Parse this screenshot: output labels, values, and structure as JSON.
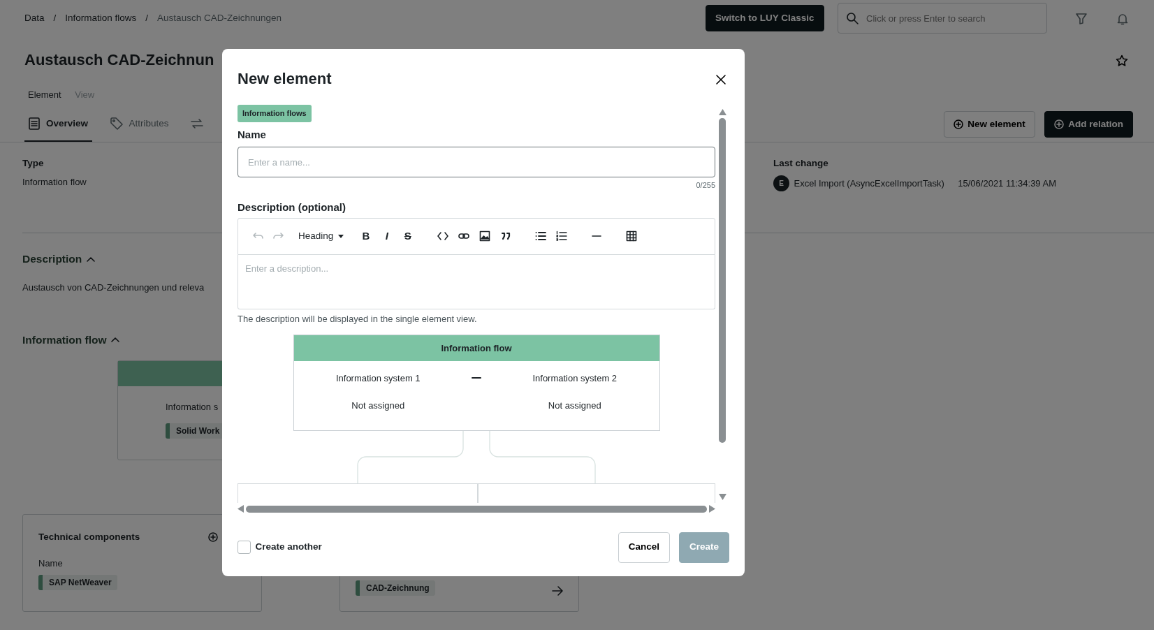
{
  "breadcrumb": [
    {
      "label": "Data",
      "current": false
    },
    {
      "label": "Information flows",
      "current": false
    },
    {
      "label": "Austausch CAD-Zeichnungen",
      "current": true
    }
  ],
  "breadcrumb_separator": "/",
  "header": {
    "switch_button": "Switch to LUY Classic",
    "search": {
      "placeholder": "Click or press Enter to search"
    }
  },
  "page": {
    "title": "Austausch CAD-Zeichnun",
    "view_tabs": [
      {
        "label": "Element",
        "selected": true
      },
      {
        "label": "View",
        "selected": false
      }
    ],
    "section_tabs": [
      {
        "label": "Overview",
        "selected": true
      },
      {
        "label": "Attributes",
        "selected": false
      },
      {
        "selected": false
      }
    ],
    "actions": [
      {
        "label": "New element",
        "kind": "outline"
      },
      {
        "label": "Add relation",
        "kind": "dark"
      }
    ],
    "type": {
      "label": "Type",
      "value": "Information flow"
    },
    "last_change": {
      "label": "Last change",
      "avatar": "E",
      "user": "Excel Import (AsyncExcelImportTask)",
      "time": "15/06/2021 11:34:39 AM"
    },
    "description": {
      "title": "Description",
      "expanded": true,
      "text": "Austausch von CAD-Zeichnungen und releva"
    },
    "information_flow": {
      "title": "Information flow",
      "expanded": true,
      "system_label": "Information s",
      "system_chip": "Solid Work"
    },
    "technical_components": {
      "title": "Technical components",
      "column": "Name",
      "items": [
        "SAP NetWeaver"
      ]
    },
    "related": {
      "chip": "CAD-Zeichnung"
    }
  },
  "modal": {
    "title": "New element",
    "type_badge": "Information flows",
    "name": {
      "label": "Name",
      "placeholder": "Enter a name...",
      "counter": "0/255"
    },
    "description": {
      "label": "Description (optional)",
      "placeholder": "Enter a description...",
      "hint": "The description will be displayed in the single element view.",
      "toolbar": [
        {
          "kind": "undo",
          "disabled": true
        },
        {
          "kind": "redo",
          "disabled": true
        },
        {
          "kind": "heading",
          "label": "Heading",
          "disabled": false
        },
        {
          "kind": "bold",
          "label": "B",
          "disabled": false
        },
        {
          "kind": "italic",
          "label": "I",
          "disabled": false
        },
        {
          "kind": "strike",
          "label": "S",
          "disabled": false
        },
        {
          "kind": "code",
          "disabled": false
        },
        {
          "kind": "link",
          "disabled": false
        },
        {
          "kind": "image",
          "disabled": false
        },
        {
          "kind": "quote",
          "disabled": false
        },
        {
          "kind": "bullets",
          "disabled": false
        },
        {
          "kind": "numbers",
          "disabled": false
        },
        {
          "kind": "rule",
          "disabled": false
        },
        {
          "kind": "table",
          "disabled": false
        }
      ]
    },
    "flow": {
      "title": "Information flow",
      "systems": [
        {
          "label": "Information system 1",
          "value": "Not assigned"
        },
        {
          "label": "Information system 2",
          "value": "Not assigned"
        }
      ]
    },
    "create_another": {
      "label": "Create another",
      "checked": false
    },
    "buttons": [
      {
        "label": "Cancel",
        "kind": "secondary",
        "disabled": false
      },
      {
        "label": "Create",
        "kind": "primary",
        "disabled": true
      }
    ]
  }
}
